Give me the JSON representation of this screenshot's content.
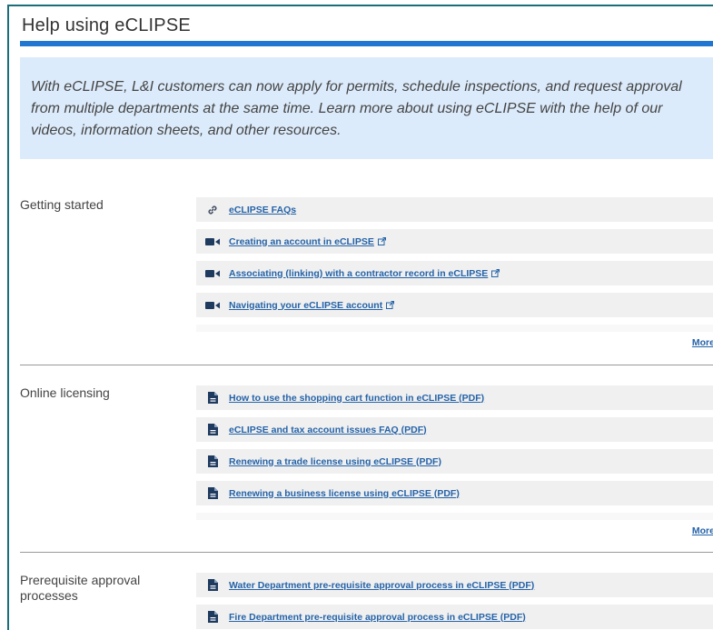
{
  "page": {
    "title": "Help using eCLIPSE",
    "intro": "With eCLIPSE, L&I customers can now apply for permits, schedule inspections, and request approval from multiple departments at the same time. Learn more about using eCLIPSE with the help of our videos, information sheets, and other resources."
  },
  "colors": {
    "accent": "#2176d2",
    "intro_bg": "#dcebfb",
    "link": "#2563a8",
    "row_bg": "#f0f0f0",
    "frame": "#1a6e7a"
  },
  "sections": [
    {
      "label": "Getting started",
      "more": "More +",
      "links": [
        {
          "icon": "link-icon",
          "text": "eCLIPSE FAQs",
          "external": false
        },
        {
          "icon": "video-icon",
          "text": "Creating an account in eCLIPSE",
          "external": true
        },
        {
          "icon": "video-icon",
          "text": "Associating (linking) with a contractor record in eCLIPSE",
          "external": true
        },
        {
          "icon": "video-icon",
          "text": "Navigating your eCLIPSE account",
          "external": true
        }
      ]
    },
    {
      "label": "Online licensing",
      "more": "More +",
      "links": [
        {
          "icon": "document-icon",
          "text": "How to use the shopping cart function in eCLIPSE (PDF)",
          "external": false
        },
        {
          "icon": "document-icon",
          "text": "eCLIPSE and tax account issues FAQ (PDF)",
          "external": false
        },
        {
          "icon": "document-icon",
          "text": "Renewing a trade license using eCLIPSE (PDF)",
          "external": false
        },
        {
          "icon": "document-icon",
          "text": "Renewing a business license using eCLIPSE (PDF)",
          "external": false
        }
      ]
    },
    {
      "label": "Prerequisite approval processes",
      "links": [
        {
          "icon": "document-icon",
          "text": "Water Department pre-requisite approval process in eCLIPSE (PDF)",
          "external": false
        },
        {
          "icon": "document-icon",
          "text": "Fire Department pre-requisite approval process in eCLIPSE (PDF)",
          "external": false
        }
      ]
    }
  ]
}
